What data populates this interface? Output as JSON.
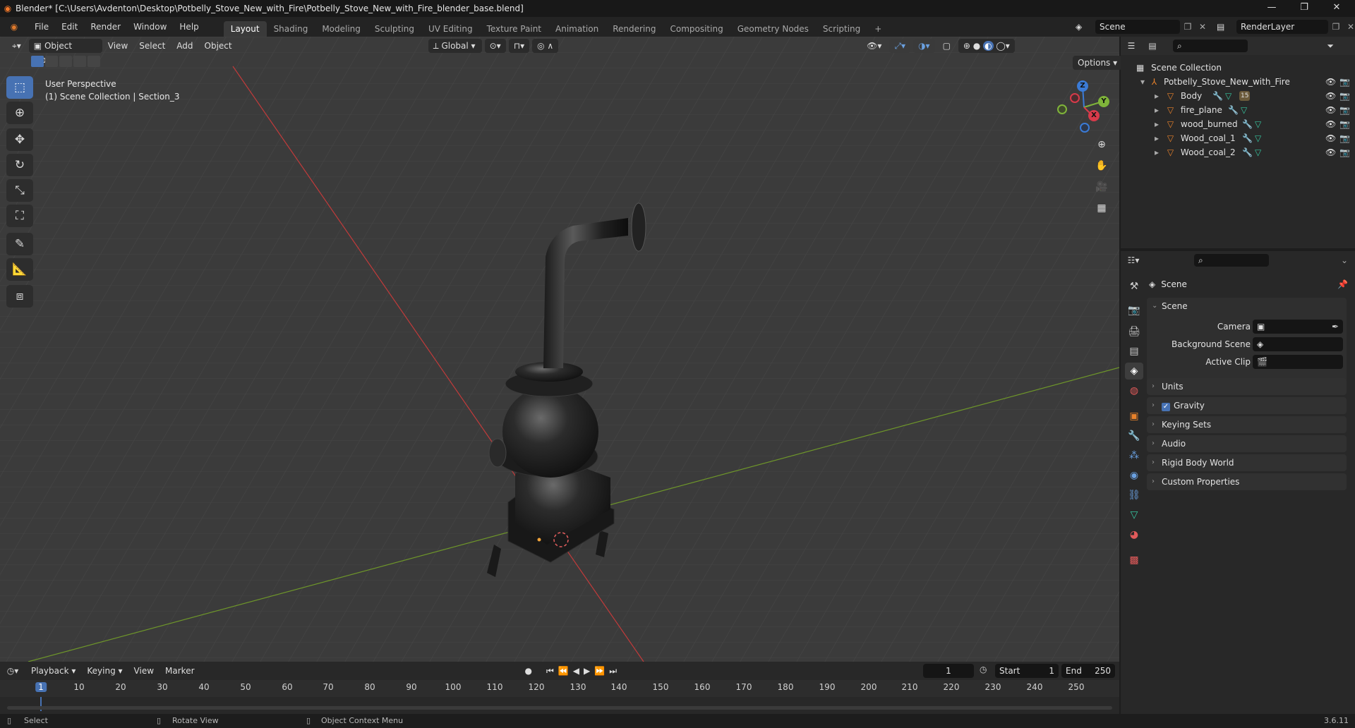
{
  "window": {
    "title": "Blender* [C:\\Users\\Avdenton\\Desktop\\Potbelly_Stove_New_with_Fire\\Potbelly_Stove_New_with_Fire_blender_base.blend]",
    "minimize": "—",
    "maximize": "❐",
    "close": "✕"
  },
  "menu": {
    "items": [
      "File",
      "Edit",
      "Render",
      "Window",
      "Help"
    ],
    "workspaces": [
      "Layout",
      "Shading",
      "Modeling",
      "Sculpting",
      "UV Editing",
      "Texture Paint",
      "Animation",
      "Rendering",
      "Compositing",
      "Geometry Nodes",
      "Scripting"
    ],
    "active_workspace": "Layout",
    "add_workspace": "+",
    "scene_name": "Scene",
    "view_layer": "RenderLayer"
  },
  "viewport": {
    "mode": "Object Mode",
    "menus": [
      "View",
      "Select",
      "Add",
      "Object"
    ],
    "transform_orientation": "Global",
    "options_label": "Options",
    "perspective_label": "User Perspective",
    "collection_label": "(1) Scene Collection | Section_3",
    "gizmo": {
      "x": "X",
      "y": "Y",
      "z": "Z"
    }
  },
  "outliner": {
    "root": "Scene Collection",
    "collection": "Potbelly_Stove_New_with_Fire",
    "objects": [
      "Body",
      "fire_plane",
      "wood_burned",
      "Wood_coal_1",
      "Wood_coal_2"
    ],
    "body_badge": "15"
  },
  "properties": {
    "context": "Scene",
    "section": "Scene",
    "fields": [
      {
        "label": "Camera",
        "value": ""
      },
      {
        "label": "Background Scene",
        "value": ""
      },
      {
        "label": "Active Clip",
        "value": ""
      }
    ],
    "panels": [
      "Units",
      "Gravity",
      "Keying Sets",
      "Audio",
      "Rigid Body World",
      "Custom Properties"
    ],
    "gravity_checked": true
  },
  "timeline": {
    "menus": [
      "Playback",
      "Keying",
      "View",
      "Marker"
    ],
    "current_frame": "1",
    "start_label": "Start",
    "start": "1",
    "end_label": "End",
    "end": "250",
    "ticks": [
      "1",
      "10",
      "20",
      "30",
      "40",
      "50",
      "60",
      "70",
      "80",
      "90",
      "100",
      "110",
      "120",
      "130",
      "140",
      "150",
      "160",
      "170",
      "180",
      "190",
      "200",
      "210",
      "220",
      "230",
      "240",
      "250"
    ]
  },
  "status": {
    "select": "Select",
    "rotate": "Rotate View",
    "context_menu": "Object Context Menu",
    "version": "3.6.11"
  },
  "colors": {
    "accent": "#4772b3",
    "x_axis": "#c43a3a",
    "y_axis": "#7aa12e",
    "object_orange": "#e8822b",
    "mesh_green": "#37c6a0"
  }
}
